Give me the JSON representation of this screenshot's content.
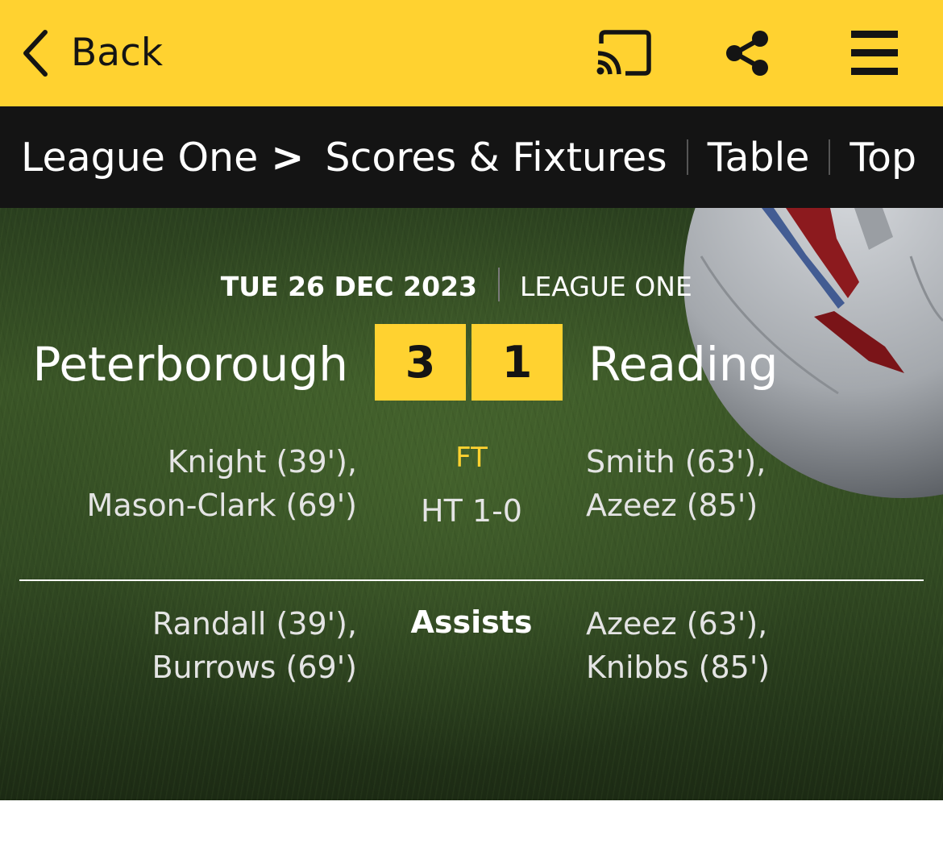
{
  "header": {
    "back_label": "Back",
    "background_color": "#ffd230",
    "icons": [
      "chevron-left-icon",
      "cast-icon",
      "share-icon",
      "menu-icon"
    ]
  },
  "nav": {
    "breadcrumb": "League One",
    "items": [
      "Scores & Fixtures",
      "Table",
      "Top"
    ]
  },
  "match": {
    "date": "TUE 26 DEC 2023",
    "competition": "LEAGUE ONE",
    "home": {
      "name": "Peterborough",
      "score": "3",
      "scorers": [
        "Knight (39'),",
        "Mason-Clark (69')"
      ],
      "assists": [
        "Randall (39'),",
        "Burrows (69')"
      ]
    },
    "away": {
      "name": "Reading",
      "score": "1",
      "scorers": [
        "Smith (63'),",
        "Azeez (85')"
      ],
      "assists": [
        "Azeez (63'),",
        "Knibbs (85')"
      ]
    },
    "status": "FT",
    "half_time": "HT 1-0",
    "assists_label": "Assists",
    "accent_color": "#ffd230"
  }
}
